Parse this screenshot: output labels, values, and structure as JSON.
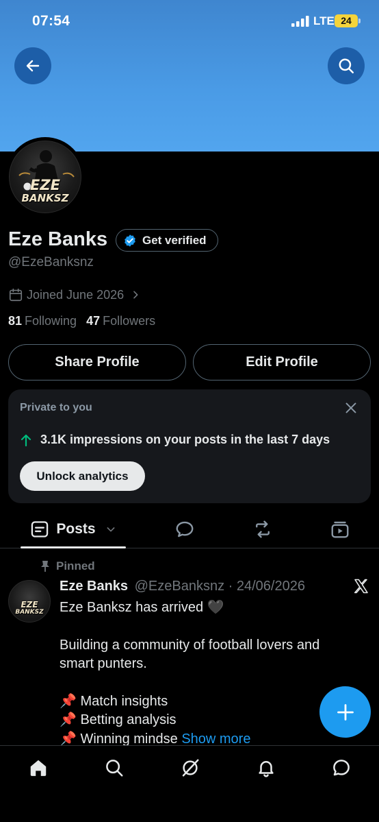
{
  "status_bar": {
    "time": "07:54",
    "network": "LTE",
    "battery": "24"
  },
  "profile": {
    "name": "Eze Banks",
    "verify_label": "Get verified",
    "handle": "@EzeBanksnz",
    "joined": "Joined June 2026",
    "following_count": "81",
    "following_label": "Following",
    "followers_count": "47",
    "followers_label": "Followers",
    "avatar_text_line1": "EZE",
    "avatar_text_line2": "BANKSZ"
  },
  "actions": {
    "share_label": "Share Profile",
    "edit_label": "Edit Profile"
  },
  "private_card": {
    "label": "Private to you",
    "impressions": "3.1K impressions on your posts in the last 7 days",
    "unlock_label": "Unlock analytics"
  },
  "tabs": {
    "posts_label": "Posts"
  },
  "post": {
    "pinned_label": "Pinned",
    "author": "Eze Banks",
    "handle_date": "@EzeBanksnz · 24/06/2026",
    "line1": "Eze Banksz has arrived 🖤",
    "line2": "Building a community of football lovers and",
    "line3": "smart punters.",
    "item1": "📌 Match insights",
    "item2": "📌 Betting analysis",
    "item3": "📌 Winning mindse",
    "show_more": "Show more"
  },
  "icons": {
    "back": "arrow-left-icon",
    "search": "search-icon",
    "verified": "verified-badge-icon",
    "calendar": "calendar-icon",
    "close": "close-icon",
    "arrow_up": "arrow-up-icon",
    "pin": "pin-icon",
    "x_logo": "x-logo-icon",
    "compose": "plus-icon"
  },
  "colors": {
    "accent": "#1d9bf0",
    "banner": "#4a9be6",
    "up_green": "#00ba7c"
  }
}
